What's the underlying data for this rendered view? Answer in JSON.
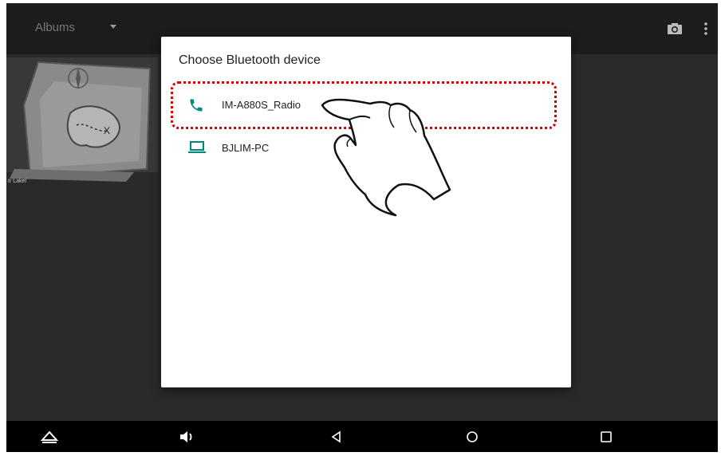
{
  "appbar": {
    "title": "Albums",
    "icons": [
      "dropdown-caret-icon",
      "camera-icon",
      "more-vert-icon"
    ]
  },
  "gallery": {
    "thumbnail_caption": "Ir Lakel"
  },
  "dialog": {
    "title": "Choose Bluetooth device",
    "devices": [
      {
        "label": "IM-A880S_Radio",
        "icon": "phone-icon",
        "highlighted": true
      },
      {
        "label": "BJLIM-PC",
        "icon": "laptop-icon",
        "highlighted": false
      }
    ]
  },
  "navbar": {
    "buttons": [
      "home-up-icon",
      "volume-icon",
      "back-icon",
      "home-circle-icon",
      "recents-icon"
    ]
  },
  "colors": {
    "accent": "#00897b",
    "highlight_border": "#d40000",
    "screen_bg": "#2a2a2a",
    "dialog_bg": "#ffffff"
  }
}
